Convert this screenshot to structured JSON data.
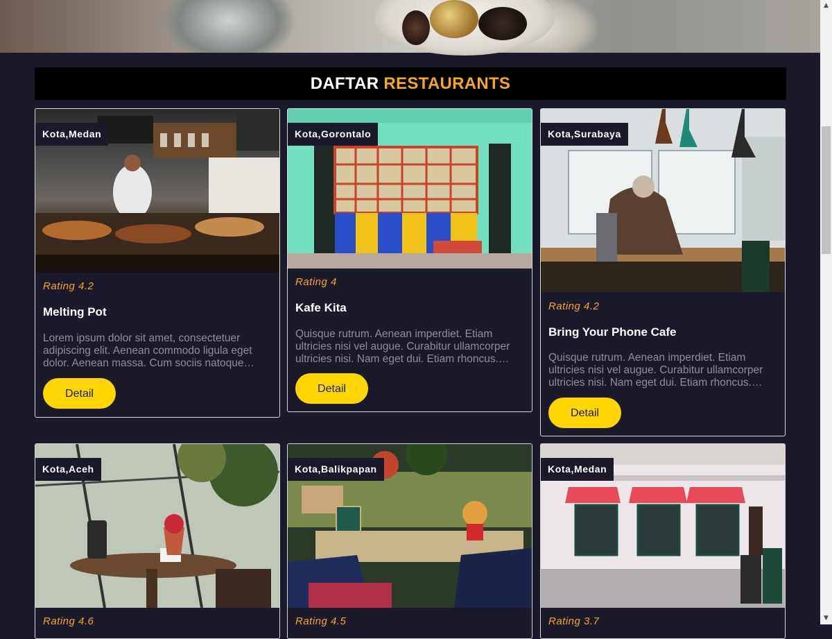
{
  "hero": {
    "image_alt": "food on table"
  },
  "section": {
    "title_plain": "DAFTAR",
    "title_accent": "RESTAURANTS",
    "accent_color": "#f5a623"
  },
  "button_color": "#ffd600",
  "restaurants": [
    {
      "city": "Kota,Medan",
      "rating": "Rating 4.2",
      "name": "Melting Pot",
      "description": "Lorem ipsum dolor sit amet, consectetuer adipiscing elit. Aenean commodo ligula eget dolor. Aenean massa. Cum sociis natoque penatibus",
      "button": "Detail"
    },
    {
      "city": "Kota,Gorontalo",
      "rating": "Rating 4",
      "name": "Kafe Kita",
      "description": "Quisque rutrum. Aenean imperdiet. Etiam ultricies nisi vel augue. Curabitur ullamcorper ultricies nisi. Nam eget dui. Etiam rhoncus. Maecenas",
      "button": "Detail"
    },
    {
      "city": "Kota,Surabaya",
      "rating": "Rating 4.2",
      "name": "Bring Your Phone Cafe",
      "description": "Quisque rutrum. Aenean imperdiet. Etiam ultricies nisi vel augue. Curabitur ullamcorper ultricies nisi. Nam eget dui. Etiam rhoncus. Maecenas",
      "button": "Detail"
    },
    {
      "city": "Kota,Aceh",
      "rating": "Rating 4.6"
    },
    {
      "city": "Kota,Balikpapan",
      "rating": "Rating 4.5"
    },
    {
      "city": "Kota,Medan",
      "rating": "Rating 3.7"
    }
  ]
}
